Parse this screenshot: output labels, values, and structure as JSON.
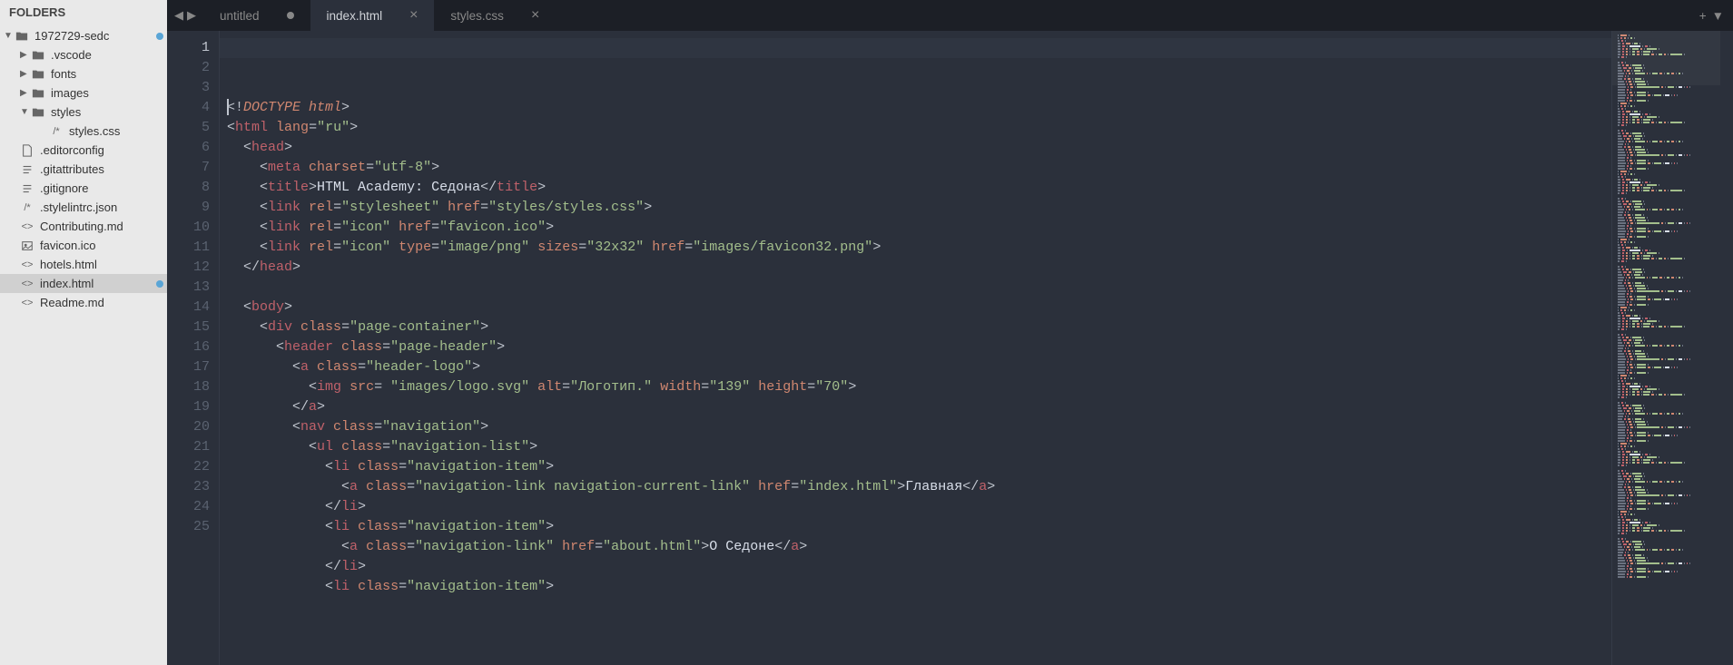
{
  "sidebar": {
    "header": "FOLDERS",
    "tree": [
      {
        "kind": "folder",
        "label": "1972729-sedc",
        "indent": 0,
        "expanded": true,
        "dirty": true
      },
      {
        "kind": "folder",
        "label": ".vscode",
        "indent": 1,
        "expanded": false
      },
      {
        "kind": "folder",
        "label": "fonts",
        "indent": 1,
        "expanded": false
      },
      {
        "kind": "folder",
        "label": "images",
        "indent": 1,
        "expanded": false
      },
      {
        "kind": "folder",
        "label": "styles",
        "indent": 1,
        "expanded": true
      },
      {
        "kind": "file",
        "label": "styles.css",
        "indent": 2,
        "icon": "comment"
      },
      {
        "kind": "file",
        "label": ".editorconfig",
        "indent": 1,
        "icon": "file"
      },
      {
        "kind": "file",
        "label": ".gitattributes",
        "indent": 1,
        "icon": "lines"
      },
      {
        "kind": "file",
        "label": ".gitignore",
        "indent": 1,
        "icon": "lines"
      },
      {
        "kind": "file",
        "label": ".stylelintrc.json",
        "indent": 1,
        "icon": "comment"
      },
      {
        "kind": "file",
        "label": "Contributing.md",
        "indent": 1,
        "icon": "code"
      },
      {
        "kind": "file",
        "label": "favicon.ico",
        "indent": 1,
        "icon": "image"
      },
      {
        "kind": "file",
        "label": "hotels.html",
        "indent": 1,
        "icon": "code"
      },
      {
        "kind": "file",
        "label": "index.html",
        "indent": 1,
        "icon": "code",
        "selected": true,
        "dirty": true
      },
      {
        "kind": "file",
        "label": "Readme.md",
        "indent": 1,
        "icon": "code"
      }
    ]
  },
  "tabs": {
    "items": [
      {
        "label": "untitled",
        "dirty": true,
        "active": false
      },
      {
        "label": "index.html",
        "dirty": false,
        "active": true,
        "closeable": true
      },
      {
        "label": "styles.css",
        "dirty": false,
        "active": false,
        "closeable": true
      }
    ]
  },
  "editor": {
    "activeLine": 1,
    "lines": [
      [
        {
          "t": "<!",
          "c": "punct"
        },
        {
          "t": "DOCTYPE html",
          "c": "doctype"
        },
        {
          "t": ">",
          "c": "punct"
        }
      ],
      [
        {
          "t": "<",
          "c": "punct"
        },
        {
          "t": "html",
          "c": "tag"
        },
        {
          "t": " ",
          "c": "punct"
        },
        {
          "t": "lang",
          "c": "attr"
        },
        {
          "t": "=",
          "c": "punct"
        },
        {
          "t": "\"ru\"",
          "c": "str"
        },
        {
          "t": ">",
          "c": "punct"
        }
      ],
      [
        {
          "t": "  <",
          "c": "punct"
        },
        {
          "t": "head",
          "c": "tag"
        },
        {
          "t": ">",
          "c": "punct"
        }
      ],
      [
        {
          "t": "    <",
          "c": "punct"
        },
        {
          "t": "meta",
          "c": "tag"
        },
        {
          "t": " ",
          "c": "punct"
        },
        {
          "t": "charset",
          "c": "attr"
        },
        {
          "t": "=",
          "c": "punct"
        },
        {
          "t": "\"utf-8\"",
          "c": "str"
        },
        {
          "t": ">",
          "c": "punct"
        }
      ],
      [
        {
          "t": "    <",
          "c": "punct"
        },
        {
          "t": "title",
          "c": "tag"
        },
        {
          "t": ">",
          "c": "punct"
        },
        {
          "t": "HTML Academy: Седона",
          "c": "text"
        },
        {
          "t": "</",
          "c": "punct"
        },
        {
          "t": "title",
          "c": "tag"
        },
        {
          "t": ">",
          "c": "punct"
        }
      ],
      [
        {
          "t": "    <",
          "c": "punct"
        },
        {
          "t": "link",
          "c": "tag"
        },
        {
          "t": " ",
          "c": "punct"
        },
        {
          "t": "rel",
          "c": "attr"
        },
        {
          "t": "=",
          "c": "punct"
        },
        {
          "t": "\"stylesheet\"",
          "c": "str"
        },
        {
          "t": " ",
          "c": "punct"
        },
        {
          "t": "href",
          "c": "attr"
        },
        {
          "t": "=",
          "c": "punct"
        },
        {
          "t": "\"styles/styles.css\"",
          "c": "str"
        },
        {
          "t": ">",
          "c": "punct"
        }
      ],
      [
        {
          "t": "    <",
          "c": "punct"
        },
        {
          "t": "link",
          "c": "tag"
        },
        {
          "t": " ",
          "c": "punct"
        },
        {
          "t": "rel",
          "c": "attr"
        },
        {
          "t": "=",
          "c": "punct"
        },
        {
          "t": "\"icon\"",
          "c": "str"
        },
        {
          "t": " ",
          "c": "punct"
        },
        {
          "t": "href",
          "c": "attr"
        },
        {
          "t": "=",
          "c": "punct"
        },
        {
          "t": "\"favicon.ico\"",
          "c": "str"
        },
        {
          "t": ">",
          "c": "punct"
        }
      ],
      [
        {
          "t": "    <",
          "c": "punct"
        },
        {
          "t": "link",
          "c": "tag"
        },
        {
          "t": " ",
          "c": "punct"
        },
        {
          "t": "rel",
          "c": "attr"
        },
        {
          "t": "=",
          "c": "punct"
        },
        {
          "t": "\"icon\"",
          "c": "str"
        },
        {
          "t": " ",
          "c": "punct"
        },
        {
          "t": "type",
          "c": "attr"
        },
        {
          "t": "=",
          "c": "punct"
        },
        {
          "t": "\"image/png\"",
          "c": "str"
        },
        {
          "t": " ",
          "c": "punct"
        },
        {
          "t": "sizes",
          "c": "attr"
        },
        {
          "t": "=",
          "c": "punct"
        },
        {
          "t": "\"32x32\"",
          "c": "str"
        },
        {
          "t": " ",
          "c": "punct"
        },
        {
          "t": "href",
          "c": "attr"
        },
        {
          "t": "=",
          "c": "punct"
        },
        {
          "t": "\"images/favicon32.png\"",
          "c": "str"
        },
        {
          "t": ">",
          "c": "punct"
        }
      ],
      [
        {
          "t": "  </",
          "c": "punct"
        },
        {
          "t": "head",
          "c": "tag"
        },
        {
          "t": ">",
          "c": "punct"
        }
      ],
      [
        {
          "t": "",
          "c": "punct"
        }
      ],
      [
        {
          "t": "  <",
          "c": "punct"
        },
        {
          "t": "body",
          "c": "tag"
        },
        {
          "t": ">",
          "c": "punct"
        }
      ],
      [
        {
          "t": "    <",
          "c": "punct"
        },
        {
          "t": "div",
          "c": "tag"
        },
        {
          "t": " ",
          "c": "punct"
        },
        {
          "t": "class",
          "c": "attr"
        },
        {
          "t": "=",
          "c": "punct"
        },
        {
          "t": "\"page-container\"",
          "c": "str"
        },
        {
          "t": ">",
          "c": "punct"
        }
      ],
      [
        {
          "t": "      <",
          "c": "punct"
        },
        {
          "t": "header",
          "c": "tag"
        },
        {
          "t": " ",
          "c": "punct"
        },
        {
          "t": "class",
          "c": "attr"
        },
        {
          "t": "=",
          "c": "punct"
        },
        {
          "t": "\"page-header\"",
          "c": "str"
        },
        {
          "t": ">",
          "c": "punct"
        }
      ],
      [
        {
          "t": "        <",
          "c": "punct"
        },
        {
          "t": "a",
          "c": "tag"
        },
        {
          "t": " ",
          "c": "punct"
        },
        {
          "t": "class",
          "c": "attr"
        },
        {
          "t": "=",
          "c": "punct"
        },
        {
          "t": "\"header-logo\"",
          "c": "str"
        },
        {
          "t": ">",
          "c": "punct"
        }
      ],
      [
        {
          "t": "          <",
          "c": "punct"
        },
        {
          "t": "img",
          "c": "tag"
        },
        {
          "t": " ",
          "c": "punct"
        },
        {
          "t": "src",
          "c": "attr"
        },
        {
          "t": "= ",
          "c": "punct"
        },
        {
          "t": "\"images/logo.svg\"",
          "c": "str"
        },
        {
          "t": " ",
          "c": "punct"
        },
        {
          "t": "alt",
          "c": "attr"
        },
        {
          "t": "=",
          "c": "punct"
        },
        {
          "t": "\"Логотип.\"",
          "c": "str"
        },
        {
          "t": " ",
          "c": "punct"
        },
        {
          "t": "width",
          "c": "attr"
        },
        {
          "t": "=",
          "c": "punct"
        },
        {
          "t": "\"139\"",
          "c": "str"
        },
        {
          "t": " ",
          "c": "punct"
        },
        {
          "t": "height",
          "c": "attr"
        },
        {
          "t": "=",
          "c": "punct"
        },
        {
          "t": "\"70\"",
          "c": "str"
        },
        {
          "t": ">",
          "c": "punct"
        }
      ],
      [
        {
          "t": "        </",
          "c": "punct"
        },
        {
          "t": "a",
          "c": "tag"
        },
        {
          "t": ">",
          "c": "punct"
        }
      ],
      [
        {
          "t": "        <",
          "c": "punct"
        },
        {
          "t": "nav",
          "c": "tag"
        },
        {
          "t": " ",
          "c": "punct"
        },
        {
          "t": "class",
          "c": "attr"
        },
        {
          "t": "=",
          "c": "punct"
        },
        {
          "t": "\"navigation\"",
          "c": "str"
        },
        {
          "t": ">",
          "c": "punct"
        }
      ],
      [
        {
          "t": "          <",
          "c": "punct"
        },
        {
          "t": "ul",
          "c": "tag"
        },
        {
          "t": " ",
          "c": "punct"
        },
        {
          "t": "class",
          "c": "attr"
        },
        {
          "t": "=",
          "c": "punct"
        },
        {
          "t": "\"navigation-list\"",
          "c": "str"
        },
        {
          "t": ">",
          "c": "punct"
        }
      ],
      [
        {
          "t": "            <",
          "c": "punct"
        },
        {
          "t": "li",
          "c": "tag"
        },
        {
          "t": " ",
          "c": "punct"
        },
        {
          "t": "class",
          "c": "attr"
        },
        {
          "t": "=",
          "c": "punct"
        },
        {
          "t": "\"navigation-item\"",
          "c": "str"
        },
        {
          "t": ">",
          "c": "punct"
        }
      ],
      [
        {
          "t": "              <",
          "c": "punct"
        },
        {
          "t": "a",
          "c": "tag"
        },
        {
          "t": " ",
          "c": "punct"
        },
        {
          "t": "class",
          "c": "attr"
        },
        {
          "t": "=",
          "c": "punct"
        },
        {
          "t": "\"navigation-link navigation-current-link\"",
          "c": "str"
        },
        {
          "t": " ",
          "c": "punct"
        },
        {
          "t": "href",
          "c": "attr"
        },
        {
          "t": "=",
          "c": "punct"
        },
        {
          "t": "\"index.html\"",
          "c": "str"
        },
        {
          "t": ">",
          "c": "punct"
        },
        {
          "t": "Главная",
          "c": "text"
        },
        {
          "t": "</",
          "c": "punct"
        },
        {
          "t": "a",
          "c": "tag"
        },
        {
          "t": ">",
          "c": "punct"
        }
      ],
      [
        {
          "t": "            </",
          "c": "punct"
        },
        {
          "t": "li",
          "c": "tag"
        },
        {
          "t": ">",
          "c": "punct"
        }
      ],
      [
        {
          "t": "            <",
          "c": "punct"
        },
        {
          "t": "li",
          "c": "tag"
        },
        {
          "t": " ",
          "c": "punct"
        },
        {
          "t": "class",
          "c": "attr"
        },
        {
          "t": "=",
          "c": "punct"
        },
        {
          "t": "\"navigation-item\"",
          "c": "str"
        },
        {
          "t": ">",
          "c": "punct"
        }
      ],
      [
        {
          "t": "              <",
          "c": "punct"
        },
        {
          "t": "a",
          "c": "tag"
        },
        {
          "t": " ",
          "c": "punct"
        },
        {
          "t": "class",
          "c": "attr"
        },
        {
          "t": "=",
          "c": "punct"
        },
        {
          "t": "\"navigation-link\"",
          "c": "str"
        },
        {
          "t": " ",
          "c": "punct"
        },
        {
          "t": "href",
          "c": "attr"
        },
        {
          "t": "=",
          "c": "punct"
        },
        {
          "t": "\"about.html\"",
          "c": "str"
        },
        {
          "t": ">",
          "c": "punct"
        },
        {
          "t": "О Седоне",
          "c": "text"
        },
        {
          "t": "</",
          "c": "punct"
        },
        {
          "t": "a",
          "c": "tag"
        },
        {
          "t": ">",
          "c": "punct"
        }
      ],
      [
        {
          "t": "            </",
          "c": "punct"
        },
        {
          "t": "li",
          "c": "tag"
        },
        {
          "t": ">",
          "c": "punct"
        }
      ],
      [
        {
          "t": "            <",
          "c": "punct"
        },
        {
          "t": "li",
          "c": "tag"
        },
        {
          "t": " ",
          "c": "punct"
        },
        {
          "t": "class",
          "c": "attr"
        },
        {
          "t": "=",
          "c": "punct"
        },
        {
          "t": "\"navigation-item\"",
          "c": "str"
        },
        {
          "t": ">",
          "c": "punct"
        }
      ]
    ]
  },
  "colors": {
    "punct": "#c0c5ce",
    "doctype": "#d08770",
    "tag": "#bf616a",
    "attr": "#d08770",
    "str": "#a3be8c",
    "text": "#d8dee9"
  }
}
